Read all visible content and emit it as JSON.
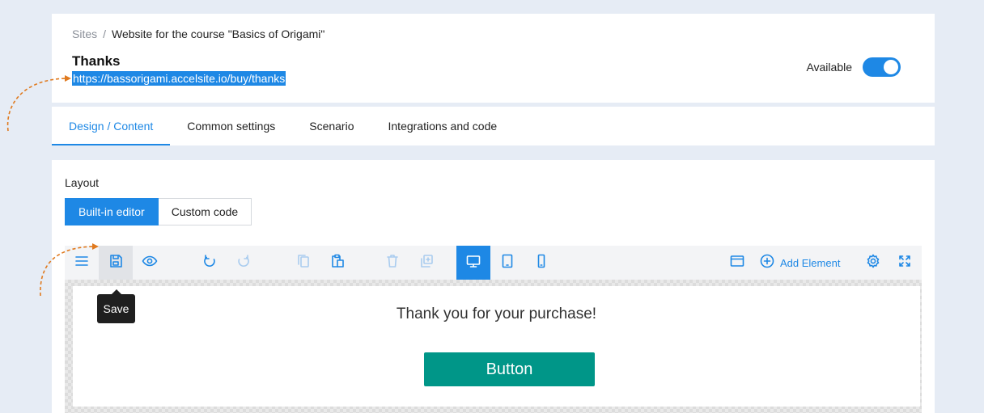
{
  "breadcrumb": {
    "root": "Sites",
    "separator": "/",
    "current": "Website for the course \"Basics of Origami\""
  },
  "page": {
    "title": "Thanks",
    "url": "https://bassorigami.accelsite.io/buy/thanks"
  },
  "availability": {
    "label": "Available",
    "enabled": true
  },
  "tabs": [
    {
      "label": "Design / Content",
      "active": true
    },
    {
      "label": "Common settings",
      "active": false
    },
    {
      "label": "Scenario",
      "active": false
    },
    {
      "label": "Integrations and code",
      "active": false
    }
  ],
  "layout": {
    "label": "Layout",
    "options": [
      {
        "label": "Built-in editor",
        "active": true
      },
      {
        "label": "Custom code",
        "active": false
      }
    ]
  },
  "toolbar": {
    "icons": [
      "menu-icon",
      "save-icon",
      "preview-icon",
      "undo-icon",
      "redo-icon",
      "copy-icon",
      "paste-icon",
      "delete-icon",
      "duplicate-icon",
      "desktop-icon",
      "tablet-icon",
      "mobile-icon",
      "window-icon",
      "add-icon",
      "settings-icon",
      "fullscreen-icon"
    ],
    "add_element_label": "Add Element",
    "active_device": "desktop",
    "tooltip": "Save"
  },
  "canvas": {
    "heading": "Thank you for your purchase!",
    "button_label": "Button"
  },
  "colors": {
    "accent": "#1e88e5",
    "button": "#009688",
    "annotation_arrow": "#e07a1f",
    "background": "#e6ecf5"
  }
}
